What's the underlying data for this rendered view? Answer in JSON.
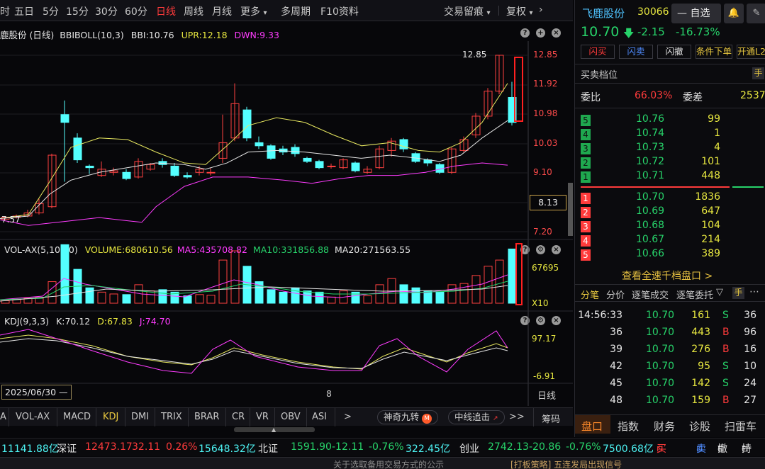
{
  "topbar": {
    "tabs": [
      "时",
      "五日",
      "5分",
      "15分",
      "30分",
      "60分",
      "日线",
      "周线",
      "月线",
      "更多",
      "多周期",
      "F10资料"
    ],
    "right_tabs": [
      "交易留痕",
      "复权"
    ],
    "active": "日线"
  },
  "main_chart": {
    "title": "鹿股份 (日线)",
    "indicator": "BBIBOLL(10,3)",
    "bbi": "BBI:10.76",
    "upr": "UPR:12.18",
    "dwn": "DWN:9.33",
    "y_labels": [
      "12.85",
      "11.92",
      "10.98",
      "10.03",
      "9.10",
      "8.13",
      "7.20"
    ],
    "high_marker": "12.85",
    "low_marker": "7.57",
    "current_price_box": "8.13"
  },
  "volume_chart": {
    "title": "VOL-AX(5,10,20)",
    "volume": "VOLUME:680610.56",
    "ma5": "MA5:435708.82",
    "ma10": "MA10:331856.88",
    "ma20": "MA20:271563.55",
    "y_labels": [
      "67695",
      "X10"
    ]
  },
  "kdj_chart": {
    "title": "KDJ(9,3,3)",
    "k": "K:70.12",
    "d": "D:67.83",
    "j": "J:74.70",
    "y_labels": [
      "97.17",
      "-6.91"
    ]
  },
  "time_axis": {
    "date_label": "2025/06/30",
    "month_label": "8",
    "period_label": "日线"
  },
  "indicator_tabs": [
    "A",
    "VOL-AX",
    "MACD",
    "KDJ",
    "DMI",
    "TRIX",
    "BRAR",
    "CR",
    "VR",
    "OBV",
    "ASI",
    ">"
  ],
  "indicator_pills": [
    "神奇九转",
    "中线追击"
  ],
  "indicator_more": ">>",
  "indicator_chip": "筹码",
  "quote": {
    "name": "飞鹿股份",
    "code": "30066",
    "watch_label": "自选",
    "price": "10.70",
    "change": "-2.15",
    "change_pct": "-16.73%",
    "buttons": [
      "闪买",
      "闪卖",
      "闪撤",
      "条件下单",
      "开通L2"
    ],
    "section_title": "买卖档位",
    "hand_label": "手",
    "weibi_label": "委比",
    "weibi_value": "66.03%",
    "weicha_label": "委差",
    "weicha_value": "2537",
    "sells": [
      {
        "lvl": "5",
        "price": "10.76",
        "vol": "99"
      },
      {
        "lvl": "4",
        "price": "10.74",
        "vol": "1"
      },
      {
        "lvl": "3",
        "price": "10.73",
        "vol": "4"
      },
      {
        "lvl": "2",
        "price": "10.72",
        "vol": "101"
      },
      {
        "lvl": "1",
        "price": "10.71",
        "vol": "448"
      }
    ],
    "buys": [
      {
        "lvl": "1",
        "price": "10.70",
        "vol": "1836"
      },
      {
        "lvl": "2",
        "price": "10.69",
        "vol": "647"
      },
      {
        "lvl": "3",
        "price": "10.68",
        "vol": "104"
      },
      {
        "lvl": "4",
        "price": "10.67",
        "vol": "214"
      },
      {
        "lvl": "5",
        "price": "10.66",
        "vol": "389"
      }
    ],
    "depth_link": "查看全速千档盘口 >",
    "detail_tabs": [
      "分笔",
      "分价",
      "逐笔成交",
      "逐笔委托"
    ],
    "ticks": [
      {
        "time": "14:56:33",
        "price": "10.70",
        "vol": "161",
        "side": "S",
        "count": "36"
      },
      {
        "time": "36",
        "price": "10.70",
        "vol": "443",
        "side": "B",
        "count": "96"
      },
      {
        "time": "39",
        "price": "10.70",
        "vol": "276",
        "side": "B",
        "count": "16"
      },
      {
        "time": "42",
        "price": "10.70",
        "vol": "95",
        "side": "S",
        "count": "10"
      },
      {
        "time": "45",
        "price": "10.70",
        "vol": "142",
        "side": "S",
        "count": "24"
      },
      {
        "time": "48",
        "price": "10.70",
        "vol": "159",
        "side": "B",
        "count": "27"
      }
    ],
    "bottom_tabs": [
      "盘口",
      "指数",
      "财务",
      "诊股",
      "扫雷车"
    ]
  },
  "ticker": {
    "items": [
      {
        "text": "11141.88亿",
        "color": "cyan"
      },
      {
        "text": "深证",
        "color": "white"
      },
      {
        "text": "12473.17",
        "color": "red"
      },
      {
        "text": "32.11",
        "color": "red"
      },
      {
        "text": "0.26%",
        "color": "red"
      },
      {
        "text": "15648.32亿",
        "color": "cyan"
      },
      {
        "text": "北证",
        "color": "white"
      },
      {
        "text": "1591.90",
        "color": "green"
      },
      {
        "text": "-12.11",
        "color": "green"
      },
      {
        "text": "-0.76%",
        "color": "green"
      },
      {
        "text": "322.45亿",
        "color": "cyan"
      },
      {
        "text": "创业",
        "color": "white"
      },
      {
        "text": "2742.13",
        "color": "green"
      },
      {
        "text": "-20.86",
        "color": "green"
      },
      {
        "text": "-0.76%",
        "color": "green"
      },
      {
        "text": "7500.68亿",
        "color": "cyan"
      }
    ],
    "actions": [
      "买",
      "卖",
      "撤",
      "持"
    ]
  },
  "bottom_strip": {
    "left": "关于选取备用交易方式的公示",
    "right": "[打板策略] 五连发局出现信号"
  }
}
